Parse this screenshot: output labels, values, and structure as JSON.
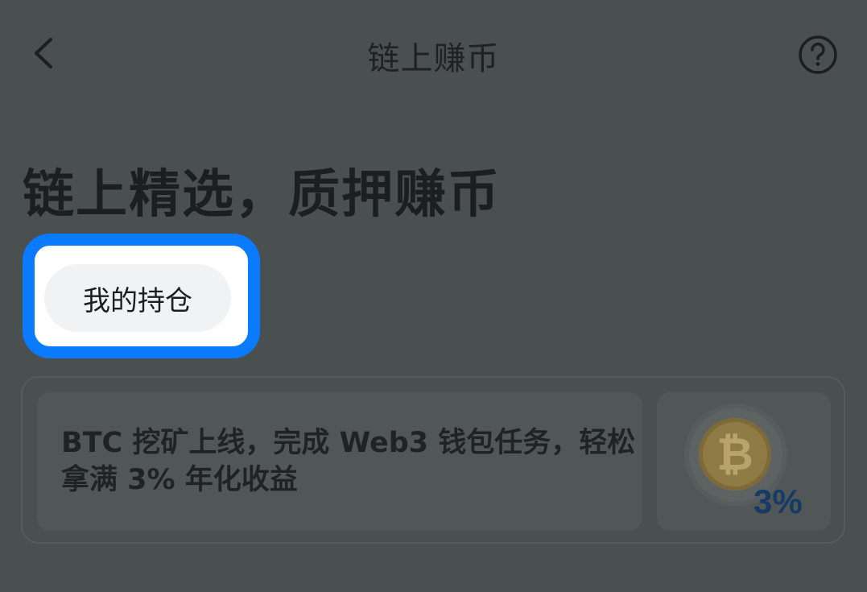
{
  "header": {
    "title": "链上赚币",
    "back_icon": "chevron-left-icon",
    "help_icon": "question-circle-icon"
  },
  "hero": {
    "title": "链上精选，质押赚币"
  },
  "actions": {
    "holdings_label": "我的持仓"
  },
  "banner": {
    "text": "BTC 挖矿上线，完成 Web3 钱包任务，轻松拿满 3% 年化收益",
    "badge": "3%",
    "coin_symbol": "₿",
    "coin_icon": "bitcoin-coin-icon"
  },
  "colors": {
    "overlay_bg": "#4a4f4f",
    "highlight": "#0a7bff",
    "button_bg": "#f1f2f4",
    "badge": "#163a66"
  }
}
